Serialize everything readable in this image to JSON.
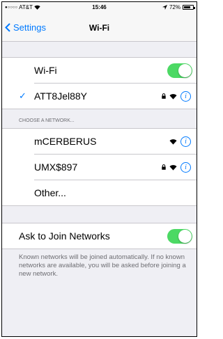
{
  "status": {
    "carrier": "AT&T",
    "time": "15:46",
    "battery": "72%",
    "battery_level": 0.72
  },
  "nav": {
    "back_label": "Settings",
    "title": "Wi-Fi"
  },
  "wifi_toggle": {
    "label": "Wi-Fi",
    "on": true
  },
  "connected_network": {
    "name": "ATT8Jel88Y"
  },
  "networks_header": "CHOOSE A NETWORK...",
  "networks": [
    {
      "name": "mCERBERUS",
      "secured": false
    },
    {
      "name": "UMX$897",
      "secured": true
    }
  ],
  "other_label": "Other...",
  "ask_to_join": {
    "label": "Ask to Join Networks",
    "on": true
  },
  "footer_note": "Known networks will be joined automatically. If no known networks are available, you will be asked before joining a new network.",
  "colors": {
    "accent": "#007aff",
    "toggle_on": "#4cd964"
  }
}
